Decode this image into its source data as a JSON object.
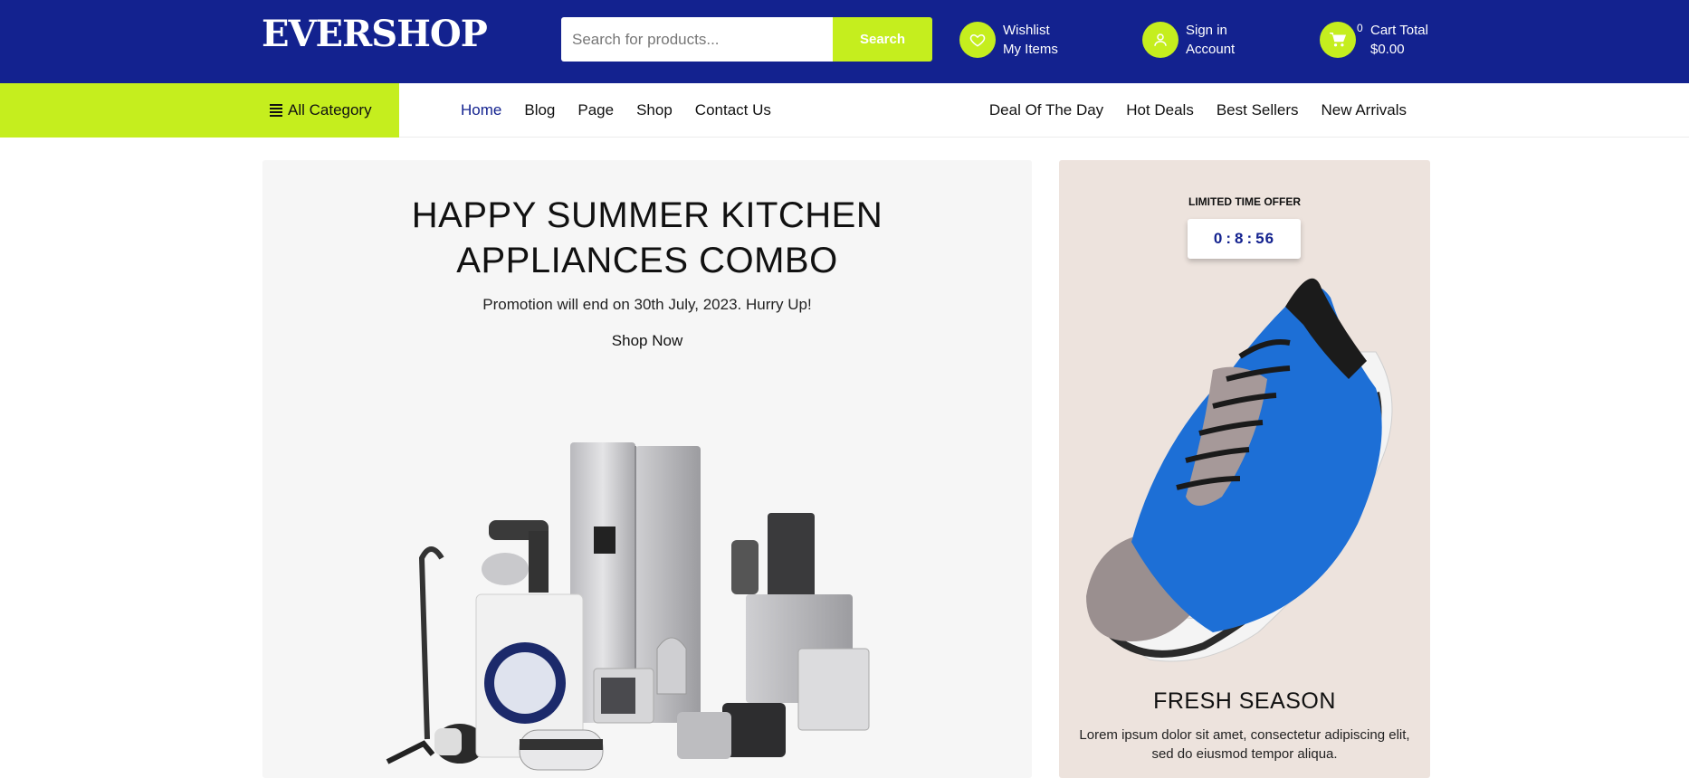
{
  "header": {
    "logo": "EVERSHOP",
    "search": {
      "placeholder": "Search for products...",
      "button_label": "Search"
    },
    "wishlist": {
      "line1": "Wishlist",
      "line2": "My Items",
      "icon": "heart-icon"
    },
    "account": {
      "line1": "Sign in",
      "line2": "Account",
      "icon": "user-icon"
    },
    "cart": {
      "count": "0",
      "line1": "Cart Total",
      "line2": "$0.00",
      "icon": "cart-icon"
    }
  },
  "nav": {
    "category_label": "All Category",
    "left_links": [
      "Home",
      "Blog",
      "Page",
      "Shop",
      "Contact Us"
    ],
    "right_links": [
      "Deal Of The Day",
      "Hot Deals",
      "Best Sellers",
      "New Arrivals"
    ]
  },
  "hero": {
    "title_line1": "HAPPY SUMMER KITCHEN",
    "title_line2": "APPLIANCES COMBO",
    "subtitle": "Promotion will end on 30th July, 2023. Hurry Up!",
    "cta": "Shop Now"
  },
  "promo": {
    "kicker": "LIMITED TIME OFFER",
    "timer": {
      "hours": "0",
      "minutes": "8",
      "seconds": "56"
    },
    "title": "FRESH SEASON",
    "text": "Lorem ipsum dolor sit amet, consectetur adipiscing elit, sed do eiusmod tempor aliqua."
  },
  "colors": {
    "brand": "#13228f",
    "accent": "#c5ee1e",
    "hero_bg": "#f6f6f6",
    "promo_bg": "#ede3dd"
  }
}
